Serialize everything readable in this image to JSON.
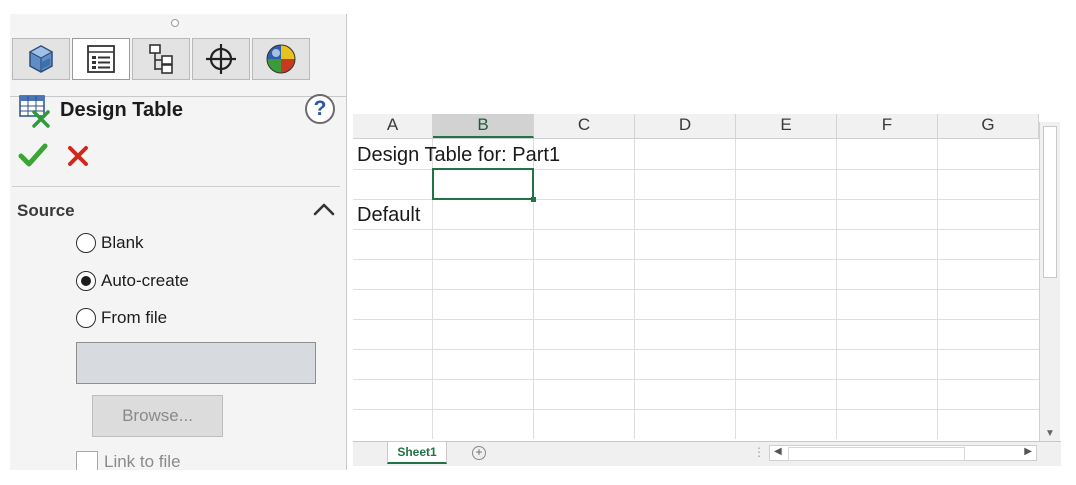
{
  "panel": {
    "title": "Design Table",
    "help_label": "?",
    "tabs": [
      {
        "icon": "feature-manager-icon",
        "active": false
      },
      {
        "icon": "property-manager-icon",
        "active": true
      },
      {
        "icon": "configuration-manager-icon",
        "active": false
      },
      {
        "icon": "dimxpert-manager-icon",
        "active": false
      },
      {
        "icon": "display-manager-icon",
        "active": false
      }
    ],
    "source": {
      "label": "Source",
      "options": [
        "Blank",
        "Auto-create",
        "From file"
      ],
      "selected": "Auto-create"
    },
    "file_path_value": "",
    "browse_label": "Browse...",
    "link_label": "Link to file"
  },
  "sheet": {
    "columns": [
      "A",
      "B",
      "C",
      "D",
      "E",
      "F",
      "G"
    ],
    "selected_column": "B",
    "cells": {
      "A1": "Design Table for: Part1",
      "A3": "Default"
    },
    "active_cell": "B2",
    "tab_name": "Sheet1"
  },
  "colors": {
    "accent_green": "#217346",
    "ok_green": "#3aa532",
    "cancel_red": "#d0281d",
    "help_blue": "#2a57a8"
  }
}
